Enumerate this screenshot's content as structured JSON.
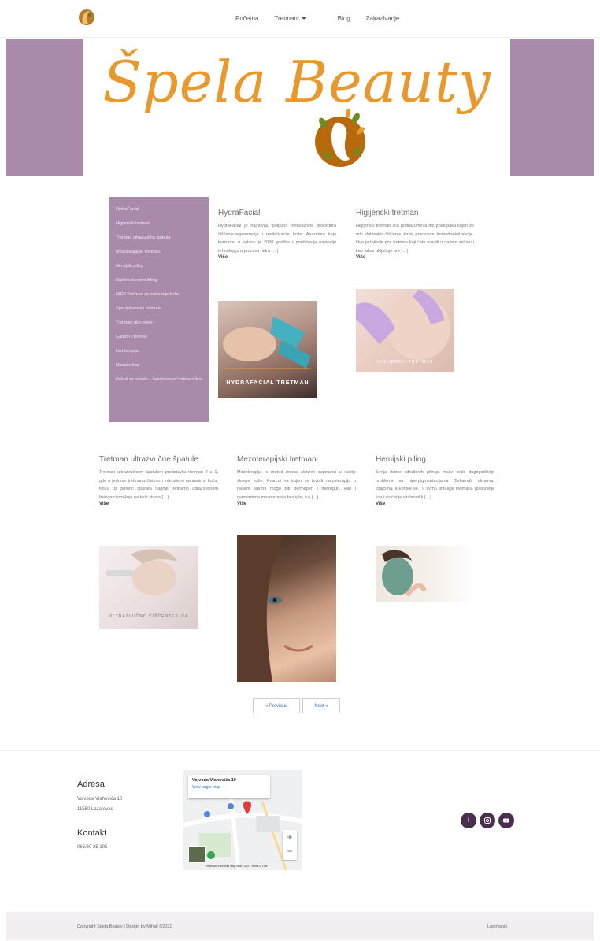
{
  "nav": {
    "links": [
      "Početna",
      "Tretmani",
      "Blog",
      "Zakazivanje"
    ]
  },
  "hero": {
    "title": "Špela Beauty"
  },
  "sidebar": {
    "items": [
      "HydraFacial",
      "Higijenski tretman",
      "Tretman ultrazvučna špatula",
      "Mezoterapijski tretmani",
      "Hemijski piling",
      "Radiofrekventni lifting",
      "HIFU Tretman za zatezanje kože",
      "Specijalizovani tretmani",
      "Tretmani oko regije",
      "Carbon Tretman",
      "Led terapija",
      "Masaža lica",
      "Paketi za pakete – kombinovani tretmani lica"
    ]
  },
  "posts": [
    {
      "title": "HydraFacial",
      "text": "HydraFacial je najnovija, potpuno neinvazivna procedura čišćenja,regeneracije i revitalizacije kože. Aparatura koja koristimo u salonu je 2020 godište i predstavlja najnoviju tehnologiju u procesu hidra […]",
      "more": "Više",
      "image_caption": "HYDRAFACIAL TRETMAN"
    },
    {
      "title": "Higijenski tretman",
      "text": "Higijenski tretman lica podrazumeva niz postupaka kojim se vrši dubinsko čišćenje kože procesom komedoekstrakcije. Ovo je takođe prvi tretman koji ćete uraditi u našem salonu i kao takav uključuje pre […]",
      "more": "Više",
      "image_caption": "HIGIJENSKI TRETMAN"
    },
    {
      "title": "Tretman ultrazvučne špatule",
      "text": "Tretman ultrazvučnom špatulom predstavlja tretman 2 u 1, gde u jednom tretmanu čistimo i intenzivno nahranimo kožu. Kožu uz pomoć aparata nagnje tretiramo ultrazvučnom frekvencijom koja na koži stvara […]",
      "more": "Više",
      "image_caption": "ULTRAZVUČNO ČIŠĆENJE LICA"
    },
    {
      "title": "Mezoterapijski tretmani",
      "text": "Mezoterapija je metod unosa aktivnih supstanci u dublje slojeve kože. Kvarcni na kojim se izvodi mezoterapija u našem salonu mogu biti dermapen i mezogun, kao i neinvazivna mezoterapija bez igle, o u […]",
      "more": "Više"
    },
    {
      "title": "Hemijski piling",
      "text": "Senja dobro odrađenih pilinga može rešiti dugogodišnje probleme sa hiperpigmentacijama (flekama), aknama, ožiljcima, a koriste se i u svrhu anti-age tretmana (zatezanje lica i vraćanje vitalnosti k […]",
      "more": "Više"
    }
  ],
  "pagination": {
    "prev": "« Previous",
    "next": "Next »"
  },
  "footer": {
    "address_heading": "Adresa",
    "address_line1": "Vojvode Vlahovića 10",
    "address_line2": "11550 Lazarevac",
    "contact_heading": "Kontakt",
    "phone": "065/60 35 105",
    "map_place": "Vojvoda Vlahovića 10",
    "map_link": "View larger map",
    "map_zoom_in": "+",
    "map_zoom_out": "−",
    "map_footer": "Keyboard shortcuts   Map data ©2021   Terms of Use",
    "copyright": "Copyright Špela Beauty | Design by Mihajl ©2021",
    "login": "Logovanje"
  },
  "colors": {
    "brand_purple": "#a98aab",
    "brand_orange": "#e8982c",
    "social_dark": "#4a2e4e"
  }
}
